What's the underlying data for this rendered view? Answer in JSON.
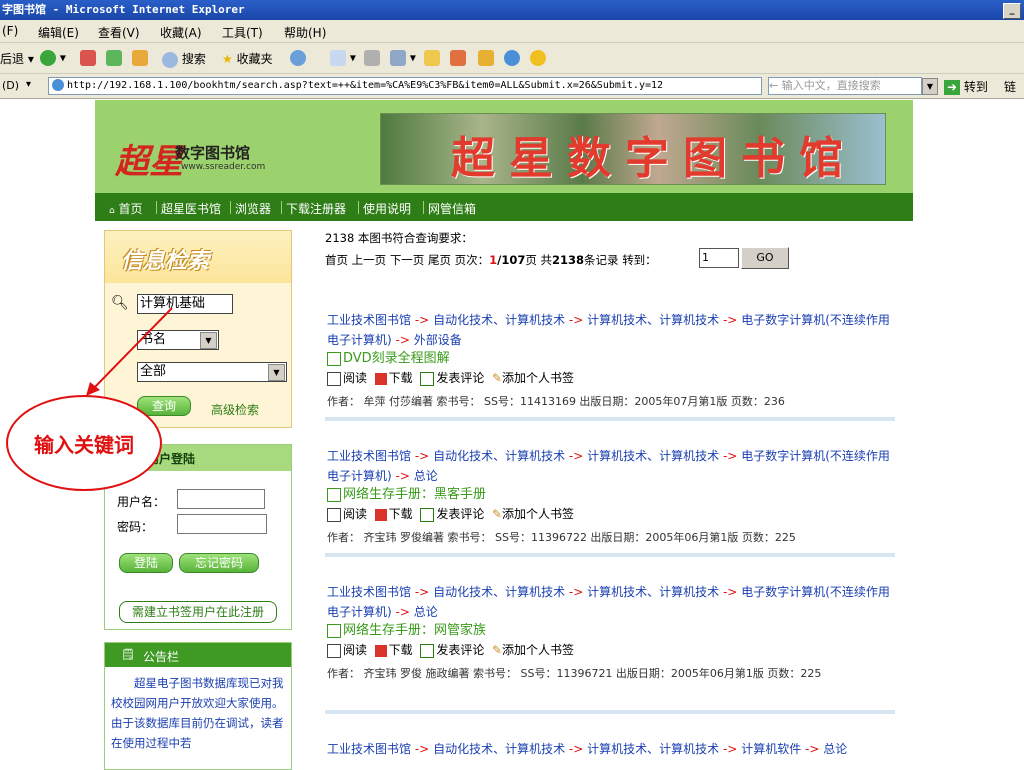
{
  "window": {
    "title": "字图书馆 - Microsoft Internet Explorer"
  },
  "menu": [
    "(F)",
    "编辑(E)",
    "查看(V)",
    "收藏(A)",
    "工具(T)",
    "帮助(H)"
  ],
  "toolbar": {
    "back": "后退",
    "search": "搜索",
    "favorites": "收藏夹"
  },
  "address": {
    "label": "(D)",
    "url": "http://192.168.1.100/bookhtm/search.asp?text=++&item=%CA%E9%C3%FB&item0=ALL&Submit.x=26&Submit.y=12",
    "search_placeholder": "← 输入中文，直接搜索",
    "go": "转到",
    "links": "链"
  },
  "banner": {
    "logo_big": "超星",
    "logo_sub": "数字图书馆",
    "logo_url": "www.ssreader.com",
    "photo_text": "超星数字图书馆"
  },
  "nav": [
    "首页",
    "超星医书馆",
    "浏览器",
    "下载注册器",
    "使用说明",
    "网管信箱"
  ],
  "sidebar": {
    "search_title": "信息检索",
    "keyword_value": "计算机基础",
    "field_select": "书名",
    "scope_select": "全部",
    "search_button": "查询",
    "advanced_link": "高级检索",
    "login_title": "用户登陆",
    "username_label": "用户名：",
    "password_label": "密码：",
    "login_button": "登陆",
    "forgot_button": "忘记密码",
    "register_button": "需建立书签用户在此注册",
    "notice_title": "公告栏",
    "notice_text": "超星电子图书数据库现已对我校校园网用户开放欢迎大家使用。由于该数据库目前仍在调试，读者在使用过程中若"
  },
  "results_header": {
    "summary": "2138 本图书符合查询要求：",
    "first": "首页",
    "prev": "上一页",
    "next": "下一页",
    "last": "尾页",
    "page_label": "页次：",
    "page_current": "1",
    "page_total": "/107",
    "page_unit": "页",
    "total_label": "共",
    "total_count": "2138",
    "total_unit": "条记录",
    "goto_label": "转到：",
    "goto_value": "1",
    "go_button": "GO"
  },
  "results": [
    {
      "category": [
        "工业技术图书馆",
        "自动化技术、计算机技术",
        "计算机技术、计算机技术",
        "电子数字计算机(不连续作用电子计算机)",
        "外部设备"
      ],
      "title": "DVD刻录全程图解",
      "actions": [
        "阅读",
        "下载",
        "发表评论",
        "添加个人书签"
      ],
      "meta": "作者： 牟萍 付莎编著 索书号：  SS号：11413169   出版日期：2005年07月第1版  页数：236"
    },
    {
      "category": [
        "工业技术图书馆",
        "自动化技术、计算机技术",
        "计算机技术、计算机技术",
        "电子数字计算机(不连续作用电子计算机)",
        "总论"
      ],
      "title": "网络生存手册：黑客手册",
      "actions": [
        "阅读",
        "下载",
        "发表评论",
        "添加个人书签"
      ],
      "meta": "作者： 齐宝玮 罗俊编著 索书号：  SS号：11396722   出版日期：2005年06月第1版  页数：225"
    },
    {
      "category": [
        "工业技术图书馆",
        "自动化技术、计算机技术",
        "计算机技术、计算机技术",
        "电子数字计算机(不连续作用电子计算机)",
        "总论"
      ],
      "title": "网络生存手册：网管家族",
      "actions": [
        "阅读",
        "下载",
        "发表评论",
        "添加个人书签"
      ],
      "meta": "作者： 齐宝玮 罗俊 施政编著 索书号：  SS号：11396721   出版日期：2005年06月第1版  页数：225"
    },
    {
      "category": [
        "工业技术图书馆",
        "自动化技术、计算机技术",
        "计算机技术、计算机技术",
        "计算机软件",
        "总论"
      ]
    }
  ],
  "annotation": {
    "text": "输入关键词"
  }
}
